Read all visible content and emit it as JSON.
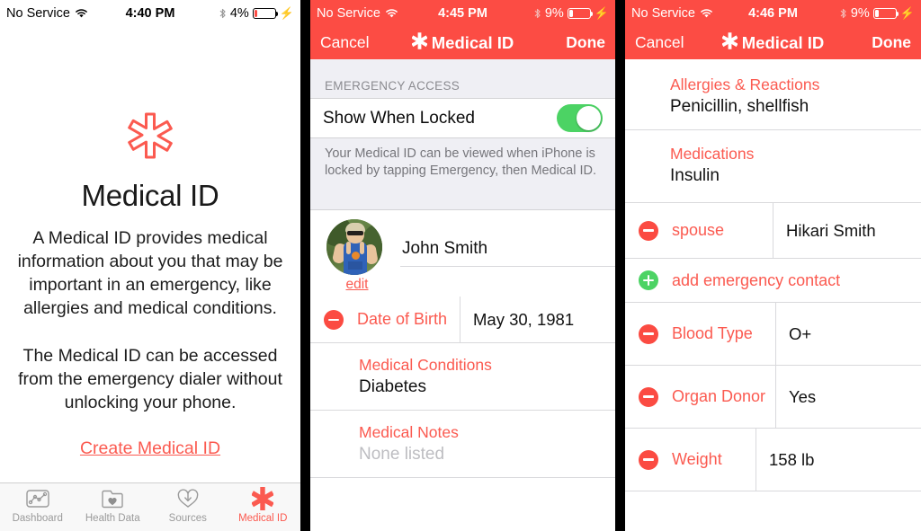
{
  "panel1": {
    "statusbar": {
      "carrier": "No Service",
      "time": "4:40 PM",
      "battery": "4%",
      "wifi_icon": "wifi-icon",
      "bluetooth_icon": "bluetooth-icon",
      "charging_icon": "charging-bolt-icon"
    },
    "intro": {
      "star_icon": "medical-star-icon",
      "title": "Medical ID",
      "paragraph1": "A Medical ID provides medical information about you that may be important in an emergency, like allergies and medical conditions.",
      "paragraph2": "The Medical ID can be accessed from the emergency dialer without unlocking your phone.",
      "cta": "Create Medical ID"
    },
    "tabs": [
      {
        "label": "Dashboard",
        "icon": "dashboard-chart-icon",
        "active": false
      },
      {
        "label": "Health Data",
        "icon": "folder-heart-icon",
        "active": false
      },
      {
        "label": "Sources",
        "icon": "heart-download-icon",
        "active": false
      },
      {
        "label": "Medical ID",
        "icon": "medical-star-icon",
        "active": true
      }
    ]
  },
  "panel2": {
    "statusbar": {
      "carrier": "No Service",
      "time": "4:45 PM",
      "battery": "9%"
    },
    "navbar": {
      "cancel": "Cancel",
      "title": "Medical ID",
      "done": "Done",
      "star_icon": "medical-star-icon"
    },
    "section_header": "EMERGENCY ACCESS",
    "show_when_locked": {
      "label": "Show When Locked",
      "toggle_on": true
    },
    "section_footer": "Your Medical ID can be viewed when iPhone is locked by tapping Emergency, then Medical ID.",
    "profile": {
      "name": "John Smith",
      "edit": "edit",
      "avatar_icon": "user-photo-avatar"
    },
    "rows": [
      {
        "label": "Date of Birth",
        "value": "May 30, 1981",
        "action": "minus"
      },
      {
        "label": "Medical Conditions",
        "value": "Diabetes",
        "style": "stacked"
      },
      {
        "label": "Medical Notes",
        "value": "None listed",
        "style": "stacked",
        "placeholder": true
      }
    ]
  },
  "panel3": {
    "statusbar": {
      "carrier": "No Service",
      "time": "4:46 PM",
      "battery": "9%"
    },
    "navbar": {
      "cancel": "Cancel",
      "title": "Medical ID",
      "done": "Done"
    },
    "rows": [
      {
        "label": "Allergies & Reactions",
        "value": "Penicillin, shellfish",
        "style": "stacked"
      },
      {
        "label": "Medications",
        "value": "Insulin",
        "style": "stacked"
      },
      {
        "label": "spouse",
        "value": "Hikari Smith",
        "action": "minus"
      },
      {
        "label": "add emergency contact",
        "action": "plus"
      },
      {
        "label": "Blood Type",
        "value": "O+",
        "action": "minus"
      },
      {
        "label": "Organ Donor",
        "value": "Yes",
        "action": "minus"
      },
      {
        "label": "Weight",
        "value": "158 lb",
        "action": "minus"
      }
    ]
  },
  "colors": {
    "accent_red": "#FB5A50",
    "navbar_red": "#FC4C44",
    "toggle_green": "#4CD364",
    "plus_green": "#4CD364",
    "minus_red": "#FB4B42"
  }
}
